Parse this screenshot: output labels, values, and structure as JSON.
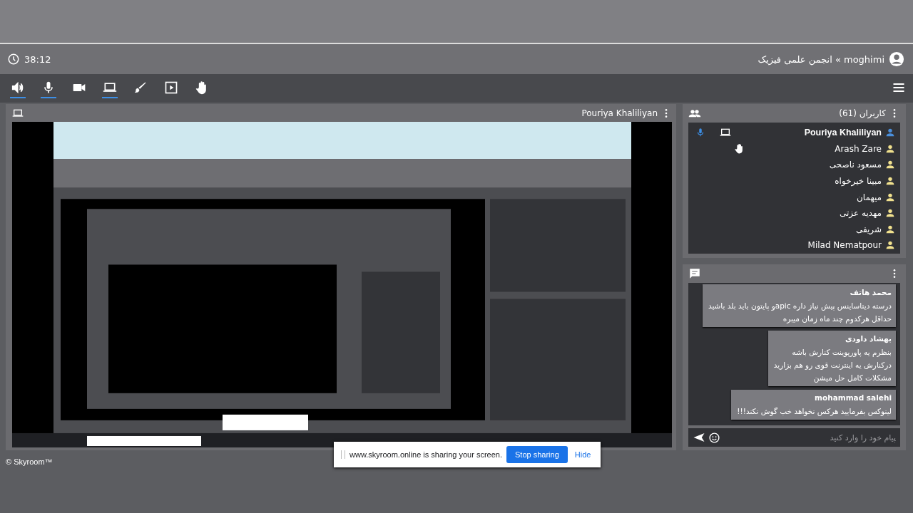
{
  "header": {
    "timer": "38:12",
    "breadcrumb": "moghimi » انجمن علمی فیزیک"
  },
  "toolbar": {
    "buttons": [
      {
        "kind": "speaker",
        "active": true
      },
      {
        "kind": "mic",
        "active": true
      },
      {
        "kind": "camera",
        "active": false
      },
      {
        "kind": "screen",
        "active": true
      },
      {
        "kind": "brush",
        "active": false
      },
      {
        "kind": "media",
        "active": false
      },
      {
        "kind": "hand",
        "active": false
      }
    ]
  },
  "video_panel": {
    "title": "Pouriya Khaliliyan"
  },
  "users_panel": {
    "title": "کاربران (61)",
    "users": [
      {
        "name": "Pouriya Khaliliyan",
        "kind": "presenter",
        "color": "#4a8fdc",
        "hand_raised": false
      },
      {
        "name": "Arash Zare",
        "kind": "user",
        "color": "#f1e18e",
        "hand_raised": true
      },
      {
        "name": "مسعود ناصحی",
        "kind": "user",
        "color": "#f1e18e",
        "hand_raised": false
      },
      {
        "name": "مبینا خیرخواه",
        "kind": "user",
        "color": "#f1e18e",
        "hand_raised": false
      },
      {
        "name": "میهمان",
        "kind": "user",
        "color": "#f1e18e",
        "hand_raised": false
      },
      {
        "name": "مهدیه عزتی",
        "kind": "user",
        "color": "#f1e18e",
        "hand_raised": false
      },
      {
        "name": "شریفی",
        "kind": "user",
        "color": "#f1e18e",
        "hand_raised": false
      },
      {
        "name": "Milad Nematpour",
        "kind": "user",
        "color": "#f1e18e",
        "hand_raised": false
      }
    ]
  },
  "chat": {
    "messages": [
      {
        "sender": "محمد هاتف",
        "lines": [
          "درسته دیتاساینس پیش نیاز داره apicو پایتون باید بلد باشید",
          "حداقل هرکدوم چند ماه زمان میبره"
        ]
      },
      {
        "sender": "بهشاد داودی",
        "lines": [
          "بنظرم یه پاورپوینت کنارش باشه",
          "درکنارش یه اینترنت قوی رو هم بزارید",
          "مشکلات کامل حل میشن"
        ]
      },
      {
        "sender": "mohammad salehi",
        "lines": [
          "لینوکس بفرمایید هرکس نخواهد خب گوش نکند!!!"
        ]
      }
    ],
    "placeholder": "پیام خود را وارد کنید"
  },
  "share_bar": {
    "message": "www.skyroom.online is sharing your screen.",
    "stop_button": "Stop sharing",
    "hide_button": "Hide"
  },
  "footer": "© Skyroom™"
}
